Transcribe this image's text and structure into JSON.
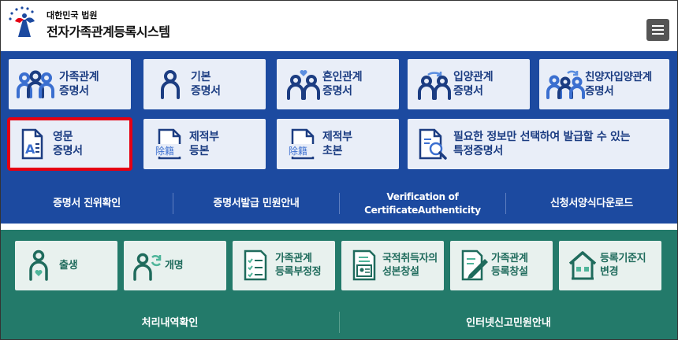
{
  "header": {
    "org": "대한민국 법원",
    "system": "전자가족관계등록시스템",
    "menu_icon": "hamburger-menu-icon"
  },
  "certificates": [
    {
      "lines": [
        "가족관계",
        "증명서"
      ],
      "icon": "family-three-people-icon"
    },
    {
      "lines": [
        "기본",
        "증명서"
      ],
      "icon": "person-icon"
    },
    {
      "lines": [
        "혼인관계",
        "증명서"
      ],
      "icon": "couple-heart-icon"
    },
    {
      "lines": [
        "입양관계",
        "증명서"
      ],
      "icon": "adoption-arrows-people-icon"
    },
    {
      "lines": [
        "친양자입양관계",
        "증명서"
      ],
      "icon": "adoption-family-icon"
    },
    {
      "lines": [
        "영문",
        "증명서"
      ],
      "icon": "english-document-icon",
      "selected": true
    },
    {
      "lines": [
        "제적부",
        "등본"
      ],
      "icon": "removed-register-document-icon",
      "badge": "除籍"
    },
    {
      "lines": [
        "제적부",
        "초본"
      ],
      "icon": "removed-register-extract-icon",
      "badge": "除籍"
    },
    {
      "lines": [
        "필요한 정보만 선택하여 발급할 수 있는",
        "특정증명서"
      ],
      "icon": "search-document-icon"
    }
  ],
  "blue_bar": [
    {
      "lines": [
        "증명서 진위확인"
      ]
    },
    {
      "lines": [
        "증명서발급 민원안내"
      ]
    },
    {
      "lines": [
        "Verification of",
        "CertificateAuthenticity"
      ]
    },
    {
      "lines": [
        "신청서양식다운로드"
      ]
    }
  ],
  "registrations": [
    {
      "lines": [
        "출생"
      ],
      "icon": "birth-mother-icon"
    },
    {
      "lines": [
        "개명"
      ],
      "icon": "rename-person-icon"
    },
    {
      "lines": [
        "가족관계",
        "등록부정정"
      ],
      "icon": "checklist-document-icon"
    },
    {
      "lines": [
        "국적취득자의",
        "성본창설"
      ],
      "icon": "id-card-document-icon"
    },
    {
      "lines": [
        "가족관계",
        "등록창설"
      ],
      "icon": "pen-document-icon"
    },
    {
      "lines": [
        "등록기준지",
        "변경"
      ],
      "icon": "house-icon"
    }
  ],
  "green_bar": [
    {
      "label": "처리내역확인"
    },
    {
      "label": "인터넷신고민원안내"
    }
  ],
  "colors": {
    "blue_panel": "#1c4aa0",
    "green_panel": "#237a6a",
    "card_blue": "#e9eef8",
    "card_green": "#e8f1ee",
    "selected_outline": "#e50012"
  }
}
